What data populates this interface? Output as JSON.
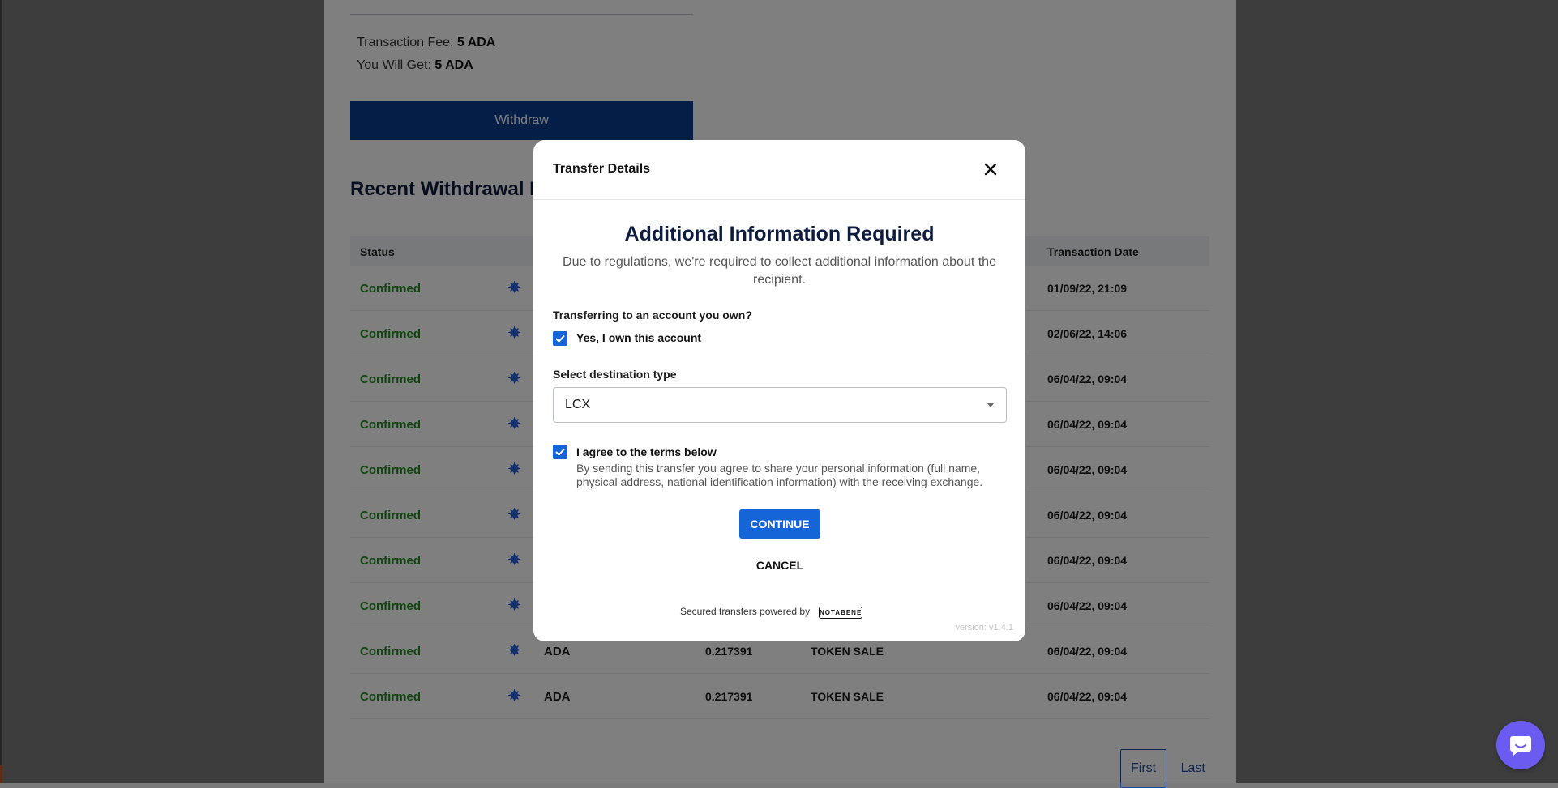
{
  "withdraw_form": {
    "fee_label": "Transaction Fee:",
    "fee_value": "5 ADA",
    "get_label": "You Will Get:",
    "get_value": "5 ADA",
    "withdraw_label": "Withdraw"
  },
  "history": {
    "title": "Recent Withdrawal H",
    "columns": {
      "status": "Status",
      "date": "Transaction Date"
    },
    "rows": [
      {
        "status": "Confirmed",
        "asset": "",
        "amount": "",
        "type": "",
        "date": "01/09/22, 21:09"
      },
      {
        "status": "Confirmed",
        "asset": "",
        "amount": "",
        "type": "",
        "date": "02/06/22, 14:06"
      },
      {
        "status": "Confirmed",
        "asset": "",
        "amount": "",
        "type": "",
        "date": "06/04/22, 09:04"
      },
      {
        "status": "Confirmed",
        "asset": "",
        "amount": "",
        "type": "",
        "date": "06/04/22, 09:04"
      },
      {
        "status": "Confirmed",
        "asset": "",
        "amount": "",
        "type": "",
        "date": "06/04/22, 09:04"
      },
      {
        "status": "Confirmed",
        "asset": "",
        "amount": "",
        "type": "",
        "date": "06/04/22, 09:04"
      },
      {
        "status": "Confirmed",
        "asset": "",
        "amount": "",
        "type": "",
        "date": "06/04/22, 09:04"
      },
      {
        "status": "Confirmed",
        "asset": "",
        "amount": "",
        "type": "",
        "date": "06/04/22, 09:04"
      },
      {
        "status": "Confirmed",
        "asset": "ADA",
        "amount": "0.217391",
        "type": "TOKEN SALE",
        "date": "06/04/22, 09:04"
      },
      {
        "status": "Confirmed",
        "asset": "ADA",
        "amount": "0.217391",
        "type": "TOKEN SALE",
        "date": "06/04/22, 09:04"
      }
    ]
  },
  "pagination": {
    "first": "First",
    "last": "Last"
  },
  "modal": {
    "title": "Transfer Details",
    "heading": "Additional Information Required",
    "subtext": "Due to regulations, we're required to collect additional information about the recipient.",
    "own_question": "Transferring to an account you own?",
    "own_checkbox_label": "Yes, I own this account",
    "own_checked": true,
    "destination_label": "Select destination type",
    "destination_value": "LCX",
    "terms_checkbox_label": "I agree to the terms below",
    "terms_checked": true,
    "terms_text": "By sending this transfer you agree to share your personal information (full name, physical address, national identification information) with the receiving exchange.",
    "continue_label": "CONTINUE",
    "cancel_label": "CANCEL",
    "powered_by": "Secured transfers powered by",
    "logo_text": "NOTABENE",
    "version": "version: v1.4.1"
  },
  "icons": {
    "close": "close-icon",
    "coin": "cardano-icon",
    "chat": "chat-icon"
  },
  "colors": {
    "primary": "#1565d8",
    "withdraw_button": "#0a3d8f",
    "confirmed": "#1d8a1d",
    "chat": "#6a5cf0"
  }
}
